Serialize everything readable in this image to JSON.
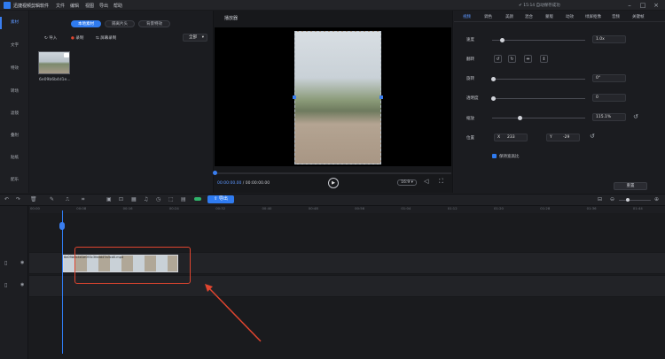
{
  "app": {
    "title": "迅捷视频剪辑软件",
    "menu": [
      "文件",
      "编辑",
      "视图",
      "导出",
      "帮助"
    ],
    "status": "✔ 15:14 自动保存成功"
  },
  "nav": {
    "items": [
      {
        "label": "素材"
      },
      {
        "label": "文字"
      },
      {
        "label": "特效"
      },
      {
        "label": "转场"
      },
      {
        "label": "滤镜"
      },
      {
        "label": "叠附"
      },
      {
        "label": "贴纸"
      },
      {
        "label": "配乐"
      }
    ]
  },
  "media": {
    "tabs": [
      "本地素材",
      "隔离片头",
      "背景特效"
    ],
    "import": "导入",
    "record": "录制",
    "screen": "屏幕录制",
    "filter": "全部",
    "file": "6e09b6b4d1e..."
  },
  "player": {
    "label": "播放器",
    "current": "00:00:00.00",
    "total": "00:00:00.00",
    "ratio": "16:9"
  },
  "props": {
    "tabs": [
      "视频",
      "调色",
      "美颜",
      "混合",
      "蒙版",
      "动效",
      "绿屏抠像",
      "音频",
      "关键帧"
    ],
    "speed_label": "速度",
    "speed": "1.0x",
    "flip_label": "翻转",
    "rotate_label": "旋转",
    "rotate": "0°",
    "opacity_label": "透明度",
    "opacity": "0",
    "scale_label": "缩放",
    "scale": "115.1%",
    "pos_label": "位置",
    "x_label": "X",
    "x": "233",
    "y_label": "Y",
    "y": "-29",
    "keep_ratio": "保持宽高比",
    "reset": "重置"
  },
  "timeline": {
    "export": "导出",
    "ticks": [
      "00:00",
      "00:08",
      "00:16",
      "00:24",
      "00:32",
      "00:40",
      "00:48",
      "00:56",
      "01:04",
      "01:12",
      "01:20",
      "01:28",
      "01:36",
      "01:44"
    ],
    "clip": "6e09b6b4d1e093c3fedd47a3cd0.mp4"
  }
}
